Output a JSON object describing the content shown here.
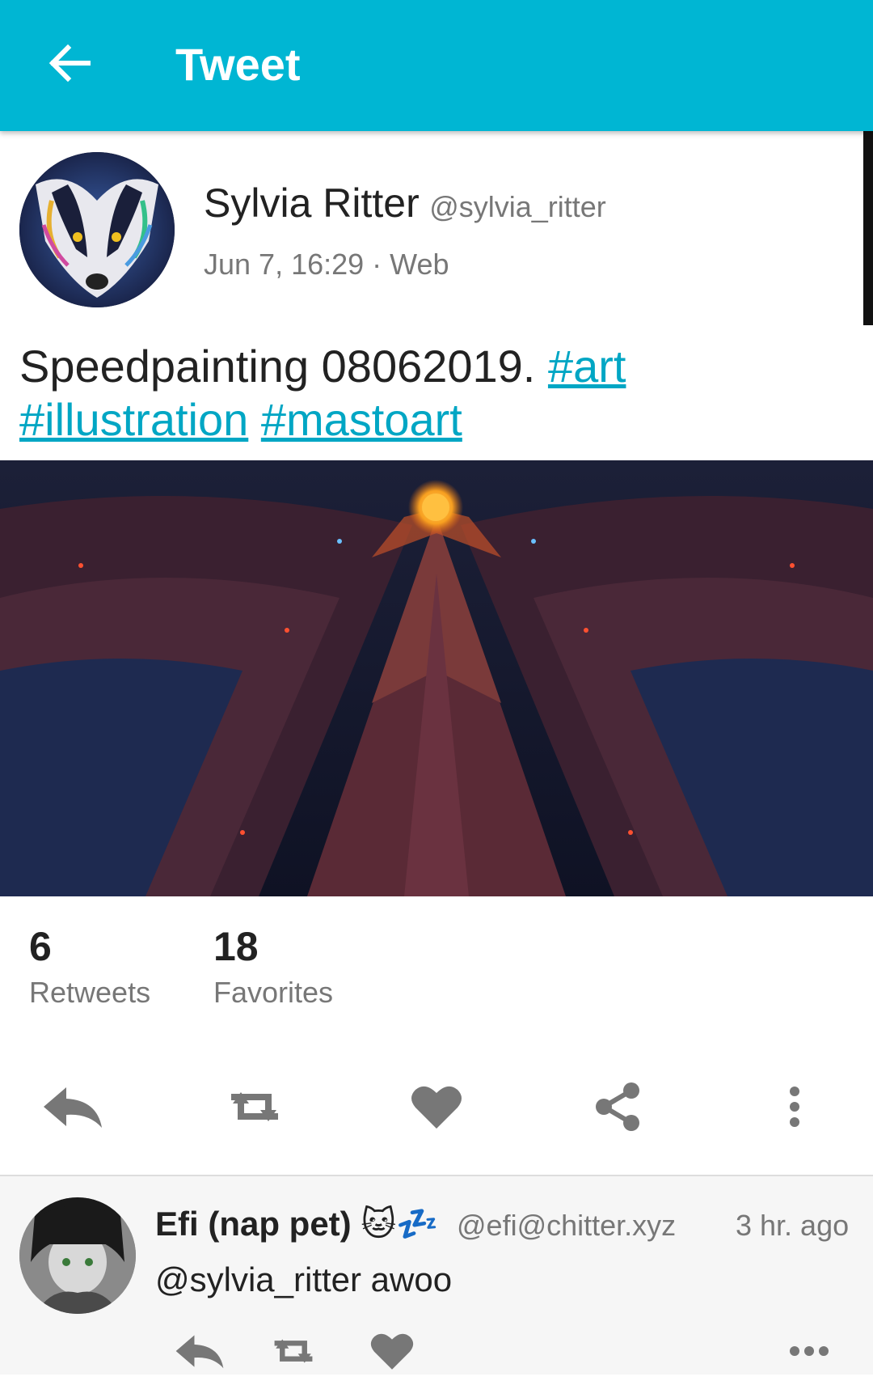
{
  "toolbar": {
    "title": "Tweet",
    "back_icon": "arrow-left-icon"
  },
  "tweet": {
    "author_name": "Sylvia Ritter",
    "author_handle": "@sylvia_ritter",
    "meta": "Jun 7, 16:29 · Web",
    "text": "Speedpainting 08062019.",
    "hashtags": [
      "#art",
      "#illustration",
      "#mastoart"
    ],
    "stats": {
      "retweets_count": "6",
      "retweets_label": "Retweets",
      "favorites_count": "18",
      "favorites_label": "Favorites"
    },
    "actions": [
      "reply-icon",
      "retweet-icon",
      "heart-icon",
      "share-icon",
      "more-vert-icon"
    ]
  },
  "reply": {
    "author_name": "Efi (nap pet)",
    "author_emoji": "🐱💤",
    "author_handle": "@efi@chitter.xyz",
    "time": "3 hr. ago",
    "text": "@sylvia_ritter awoo",
    "actions": [
      "reply-icon",
      "retweet-icon",
      "heart-icon",
      "more-horiz-icon"
    ]
  },
  "colors": {
    "toolbar": "#00B6D3",
    "link": "#00A6C4",
    "icon": "#777777"
  }
}
